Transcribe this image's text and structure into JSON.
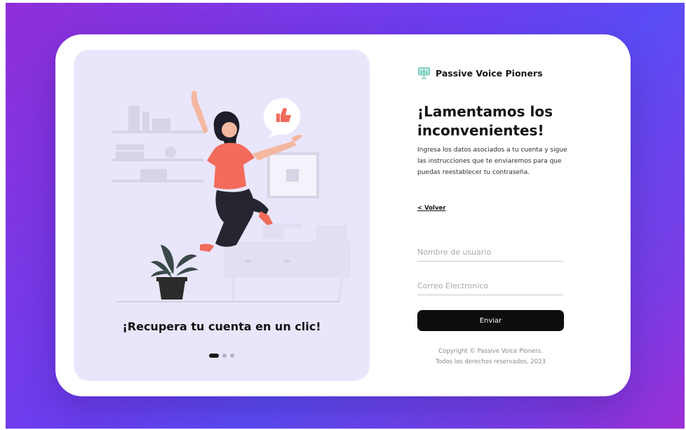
{
  "brand": {
    "name": "Passive Voice Pioners",
    "icon": "presentation-board-icon"
  },
  "left": {
    "caption": "¡Recupera tu cuenta en un clic!",
    "carousel": {
      "total": 3,
      "active": 0
    }
  },
  "form": {
    "title": "¡Lamentamos los inconvenientes!",
    "description": "Ingresa los datos asociados a tu cuenta y sigue las instrucciones que te enviaremos para que puedas reestablecer tu contraseña.",
    "back_link": "< Volver",
    "username_placeholder": "Nombre de usuario",
    "username_value": "",
    "email_placeholder": "Correo Electronico",
    "email_value": "",
    "submit_label": "Enviar"
  },
  "footer": {
    "line1": "Copyright © Passive Voice Pioners.",
    "line2": "Todos los derechos reservados, 2023"
  },
  "colors": {
    "background_gradient_start": "#8f2fd8",
    "background_gradient_mid": "#5b4cf5",
    "panel": "#e9e6fc",
    "button": "#0f0e0e",
    "brand_icon": "#7fd1c1",
    "accent_shirt": "#f26b5b"
  }
}
